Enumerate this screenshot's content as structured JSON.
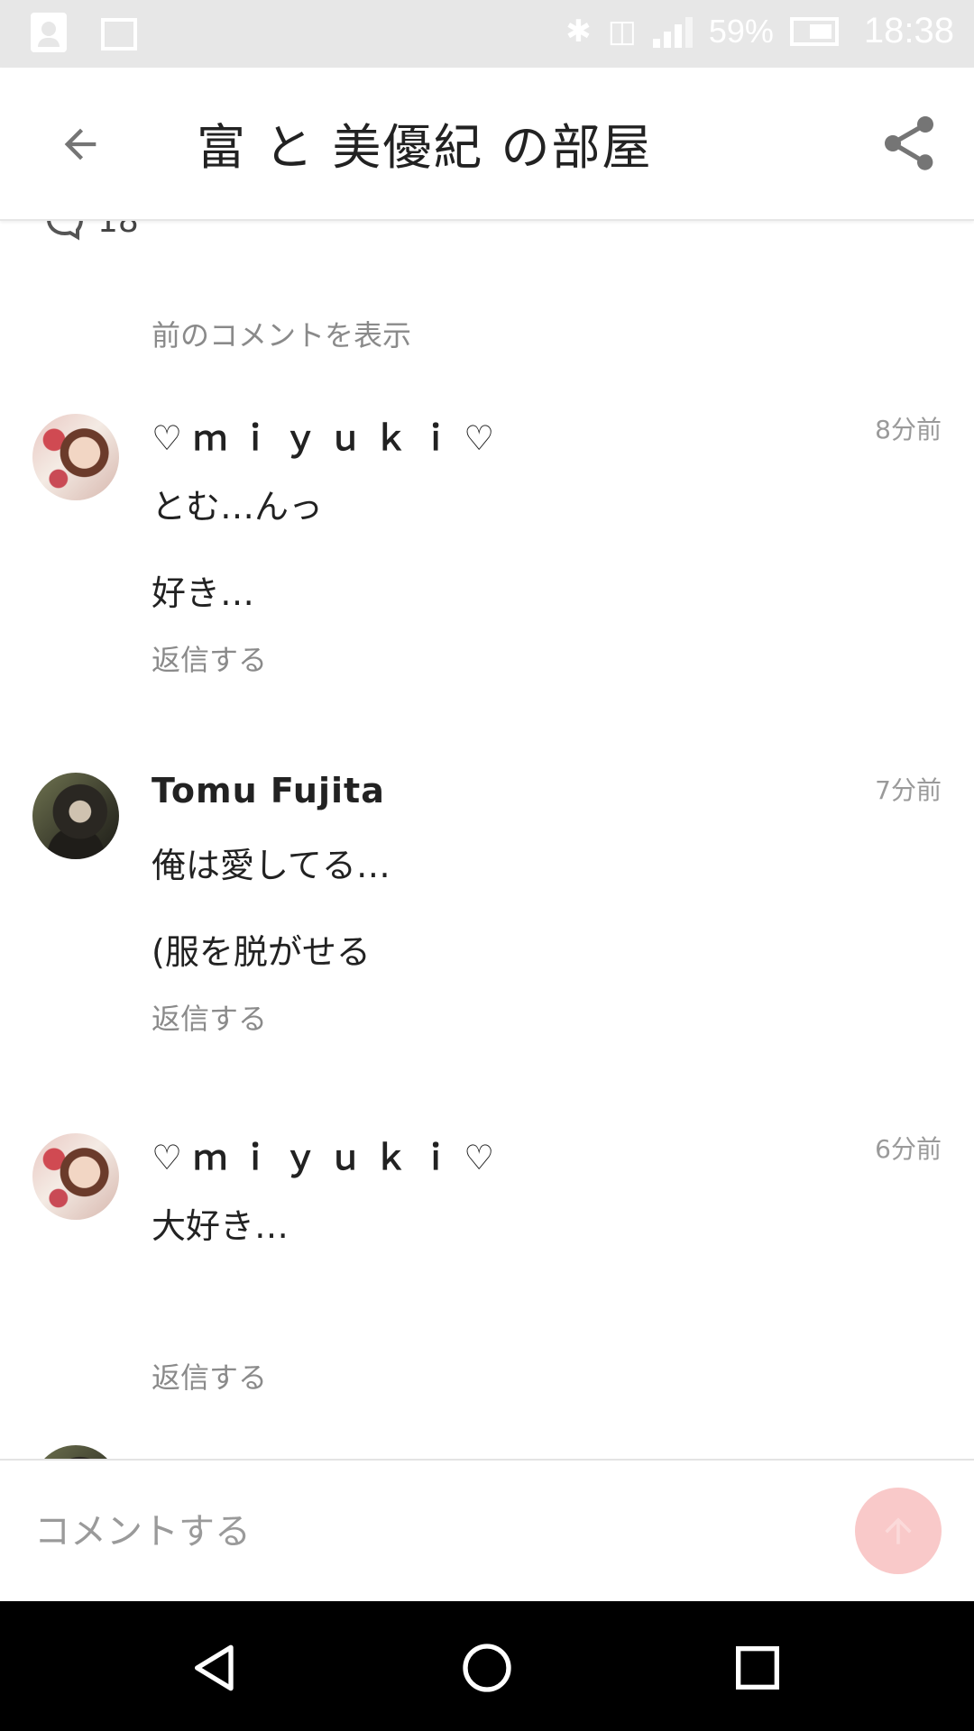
{
  "status_bar": {
    "battery": "59%",
    "time": "18:38",
    "network": "4G",
    "icons": [
      "contacts-icon",
      "mail-icon",
      "bluetooth-icon",
      "nfc-icon",
      "signal-icon",
      "battery-icon"
    ]
  },
  "app_bar": {
    "title": "富 と 美優紀 の部屋",
    "back_icon": "arrow-left-icon",
    "share_icon": "share-icon"
  },
  "thread": {
    "comment_count": "18",
    "show_previous": "前のコメントを表示"
  },
  "comments": [
    {
      "user": "♡ｍｉｙｕｋｉ♡",
      "time": "8分前",
      "lines": [
        "とむ…んっ",
        "好き…"
      ],
      "reply": "返信する"
    },
    {
      "user": "Tomu Fujita",
      "time": "7分前",
      "lines": [
        "俺は愛してる…",
        "(服を脱がせる"
      ],
      "reply": "返信する"
    },
    {
      "user": "♡ｍｉｙｕｋｉ♡",
      "time": "6分前",
      "lines": [
        "大好き…"
      ],
      "reply": "返信する"
    }
  ],
  "comment_input": {
    "placeholder": "コメントする",
    "value": ""
  },
  "colors": {
    "status_bar_bg": "#e7e7e7",
    "send_button": "#f9c9c9",
    "secondary_text": "#8a8a8a"
  },
  "nav_bar": [
    "back-triangle-icon",
    "home-circle-icon",
    "recents-square-icon"
  ]
}
